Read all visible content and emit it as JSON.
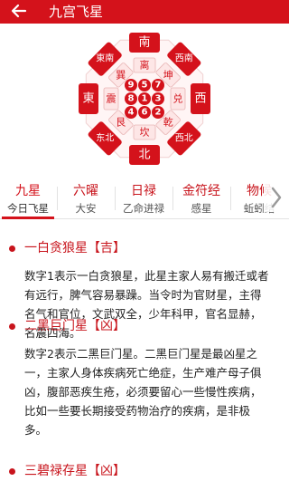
{
  "header": {
    "title": "九宫飞星",
    "bg_color": "#d4121b"
  },
  "bagua": {
    "center_grid": [
      "9",
      "5",
      "7",
      "8",
      "1",
      "3",
      "4",
      "6",
      "2"
    ],
    "trigrams": [
      "离",
      "坤",
      "兑",
      "乾",
      "坎",
      "艮",
      "震",
      "巽"
    ],
    "directions": [
      "南",
      "西南",
      "西",
      "西北",
      "北",
      "东北",
      "東",
      "東南"
    ]
  },
  "tabs": [
    {
      "label": "九星",
      "sub": "今日飞星"
    },
    {
      "label": "六曜",
      "sub": "大安"
    },
    {
      "label": "日禄",
      "sub": "乙命进禄"
    },
    {
      "label": "金符经",
      "sub": "感星"
    },
    {
      "label": "物候",
      "sub": "蚯蚓结"
    }
  ],
  "stars": [
    {
      "title": "一白贪狼星【吉】",
      "lines": [
        "数字1表示一白贪狼星，此星主家人易有搬迁或者",
        "有远行，脾气容易暴躁。当令时为官财星，主得",
        "名气和官位，文武双全，少年科甲，官名显赫，",
        "名震四海。"
      ]
    },
    {
      "title": "二黑巨门星【凶】",
      "lines": [
        "数字2表示二黑巨门星。二黑巨门星是最凶星之",
        "一，主家人身体疾病死亡绝症，生产难产母子俱",
        "凶，腹部恶疾生疮，必须要留心一些慢性疾病，",
        "比如一些要长期接受药物治疗的疾病，是非极",
        "多。"
      ]
    },
    {
      "title": "三碧禄存星【凶】",
      "lines": []
    }
  ]
}
